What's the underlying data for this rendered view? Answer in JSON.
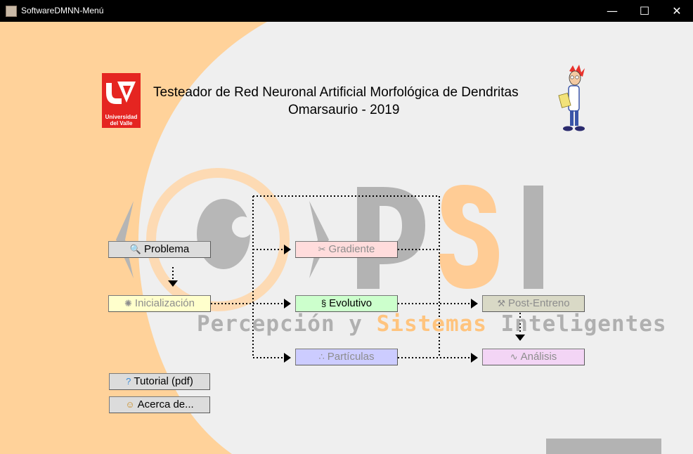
{
  "window": {
    "title": "SoftwareDMNN-Menú",
    "minimize_glyph": "—",
    "maximize_glyph": "☐",
    "close_glyph": "✕"
  },
  "header": {
    "title": "Testeador de Red Neuronal Artificial Morfológica de Dendritas",
    "subtitle": "Omarsaurio - 2019"
  },
  "logo": {
    "university_line1": "Universidad",
    "university_line2": "del Valle"
  },
  "watermark": {
    "letters": "PSI",
    "tag_part1": "Percepción y ",
    "tag_part2": "Sistemas",
    "tag_part3": " Inteligentes"
  },
  "buttons": {
    "problema": {
      "label": "Problema",
      "icon": "magnifier-icon",
      "enabled": true,
      "color": "#dcdcdc"
    },
    "gradiente": {
      "label": "Gradiente",
      "icon": "tools-icon",
      "enabled": false,
      "color": "#ffdcdc"
    },
    "inicializacion": {
      "label": "Inicialización",
      "icon": "sparkle-icon",
      "enabled": false,
      "color": "#ffffcc"
    },
    "evolutivo": {
      "label": "Evolutivo",
      "icon": "dna-icon",
      "enabled": true,
      "color": "#ccffcc"
    },
    "post_entreno": {
      "label": "Post-Entreno",
      "icon": "wrench-icon",
      "enabled": false,
      "color": "#d9d9c6"
    },
    "particulas": {
      "label": "Partículas",
      "icon": "particles-icon",
      "enabled": false,
      "color": "#ccccff"
    },
    "analisis": {
      "label": "Análisis",
      "icon": "chart-icon",
      "enabled": false,
      "color": "#f3d5f5"
    },
    "tutorial": {
      "label": "Tutorial (pdf)",
      "icon": "help-icon",
      "enabled": true,
      "color": "#dcdcdc"
    },
    "acerca": {
      "label": "Acerca de...",
      "icon": "person-icon",
      "enabled": true,
      "color": "#dcdcdc"
    }
  },
  "colors": {
    "peach": "#ffd29a",
    "orange": "#ffbf70",
    "watermark_gray": "#b4b4b4",
    "uv_red": "#e52521"
  }
}
